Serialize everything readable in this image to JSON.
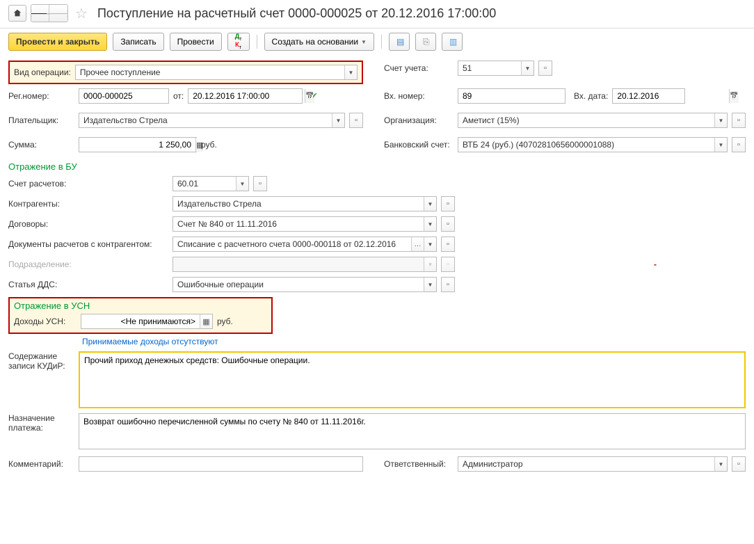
{
  "header": {
    "title": "Поступление на расчетный счет 0000-000025 от 20.12.2016 17:00:00"
  },
  "toolbar": {
    "post_and_close": "Провести и закрыть",
    "save": "Записать",
    "post": "Провести",
    "create_based": "Создать на основании"
  },
  "operation": {
    "label": "Вид операции:",
    "value": "Прочее поступление"
  },
  "account": {
    "label": "Счет учета:",
    "value": "51"
  },
  "regnum": {
    "label": "Рег.номер:",
    "value": "0000-000025",
    "date_label": "от:",
    "date": "20.12.2016 17:00:00"
  },
  "incoming": {
    "num_label": "Вх. номер:",
    "num": "89",
    "date_label": "Вх. дата:",
    "date": "20.12.2016"
  },
  "payer": {
    "label": "Плательщик:",
    "value": "Издательство Стрела"
  },
  "org": {
    "label": "Организация:",
    "value": "Аметист (15%)"
  },
  "sum": {
    "label": "Сумма:",
    "value": "1 250,00",
    "currency": "руб."
  },
  "bank": {
    "label": "Банковский счет:",
    "value": "ВТБ 24 (руб.) (40702810656000001088)"
  },
  "bu": {
    "title": "Отражение в БУ",
    "calc_account_label": "Счет расчетов:",
    "calc_account": "60.01",
    "contragent_label": "Контрагенты:",
    "contragent": "Издательство Стрела",
    "contract_label": "Договоры:",
    "contract": "Счет № 840 от 11.11.2016",
    "doc_label": "Документы расчетов с контрагентом:",
    "doc": "Списание с расчетного счета 0000-000118 от 02.12.2016",
    "dept_label": "Подразделение:",
    "dept": "",
    "dds_label": "Статья ДДС:",
    "dds": "Ошибочные операции"
  },
  "usn": {
    "title": "Отражение в УСН",
    "income_label": "Доходы УСН:",
    "income_value": "<Не принимаются>",
    "currency": "руб.",
    "note": "Принимаемые доходы отсутствуют"
  },
  "kudir": {
    "label": "Содержание записи КУДиР:",
    "value": "Прочий приход денежных средств: Ошибочные операции."
  },
  "purpose": {
    "label": "Назначение платежа:",
    "value": "Возврат ошибочно перечисленной суммы по счету № 840 от 11.11.2016г."
  },
  "footer": {
    "comment_label": "Комментарий:",
    "comment": "",
    "responsible_label": "Ответственный:",
    "responsible": "Администратор"
  }
}
